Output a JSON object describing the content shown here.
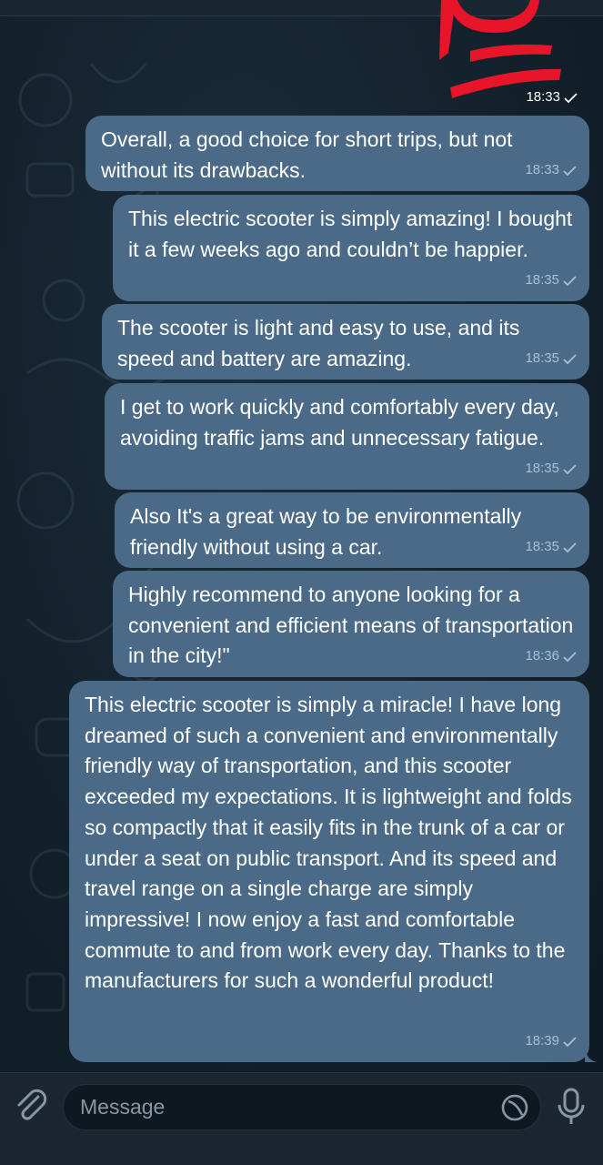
{
  "composer": {
    "placeholder": "Message"
  },
  "sticker": {
    "time": "18:33"
  },
  "messages": [
    {
      "text": "Overall, a good choice for short trips, but not without its drawbacks.",
      "time": "18:33"
    },
    {
      "text": "This electric scooter is simply amazing! I bought it a few weeks ago and couldn’t be happier.",
      "time": "18:35"
    },
    {
      "text": "The scooter is light and easy to use, and its speed and battery are amazing.",
      "time": "18:35"
    },
    {
      "text": "I get to work quickly and comfortably every day, avoiding traffic jams and unnecessary fatigue.",
      "time": "18:35"
    },
    {
      "text": "Also It's a great way to be environmentally friendly without using a car.",
      "time": "18:35"
    },
    {
      "text": "Highly recommend to anyone looking for a convenient and efficient means of transportation in the city!\"",
      "time": "18:36"
    },
    {
      "text": "This electric scooter is simply a miracle! I have long dreamed of such a convenient and environmentally friendly way of transportation, and this scooter exceeded my expectations. It is lightweight and folds so compactly that it easily fits in the trunk of a car or under a seat on public transport. And its speed and travel range on a single charge are simply impressive! I now enjoy a fast and comfortable commute to and from work every day. Thanks to the manufacturers for such a wonderful product!",
      "time": "18:39"
    }
  ],
  "colors": {
    "bubble_outgoing": "#4a6a87",
    "chat_background": "#13212c",
    "sticker_red": "#e8142a"
  },
  "icons": {
    "read_status": "single-check-icon",
    "attach": "paperclip-icon",
    "sticker": "sticker-icon",
    "voice": "microphone-icon"
  }
}
